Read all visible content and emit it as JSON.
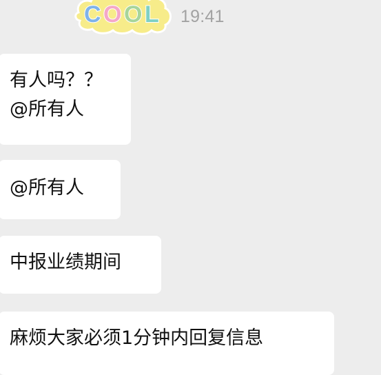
{
  "sticker": {
    "text": "COOL",
    "colors": {
      "C": "#7fb3ea",
      "O1": "#f4a8c8",
      "O2": "#a7d59a",
      "L": "#7ed0c4",
      "background": "#f7ec8a",
      "outline": "#ffffff"
    }
  },
  "header": {
    "timestamp": "19:41"
  },
  "messages": [
    {
      "text": "有人吗？？\n@所有人"
    },
    {
      "text": "@所有人"
    },
    {
      "text": "中报业绩期间"
    },
    {
      "text": "麻烦大家必须1分钟内回复信息"
    }
  ]
}
